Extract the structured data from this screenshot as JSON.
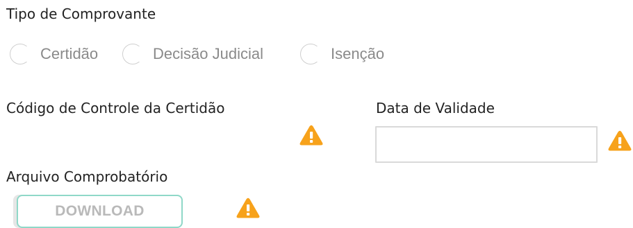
{
  "proof_type": {
    "title": "Tipo de Comprovante",
    "options": [
      {
        "label": "Certidão",
        "selected": false
      },
      {
        "label": "Decisão Judicial",
        "selected": false
      },
      {
        "label": "Isenção",
        "selected": false
      }
    ]
  },
  "control_code": {
    "label": "Código de Controle da Certidão",
    "warning_icon": "warning-triangle-icon"
  },
  "validity_date": {
    "label": "Data de Validade",
    "value": "",
    "warning_icon": "warning-triangle-icon"
  },
  "supporting_file": {
    "label": "Arquivo Comprobatório",
    "download_label": "DOWNLOAD",
    "warning_icon": "warning-triangle-icon"
  },
  "colors": {
    "warning": "#f7a21b",
    "button_border": "#8fd8c8",
    "muted_text": "#8a8a8a"
  }
}
